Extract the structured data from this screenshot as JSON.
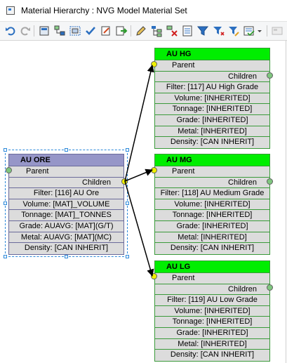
{
  "window": {
    "title": "Material Hierarchy : NVG Model Material Set"
  },
  "toolbar": {
    "items": [
      "undo-icon",
      "redo-icon",
      "layout-icon",
      "network-icon",
      "select-icon",
      "check-icon",
      "edit-icon",
      "export-icon",
      "pencil-icon",
      "tree-icon",
      "delete-icon",
      "properties-icon",
      "filter-icon",
      "filter-add-icon",
      "filter-edit-icon",
      "filter-clear-icon",
      "dropdown-icon",
      "disabled-icon"
    ]
  },
  "colors": {
    "green_header": "#00ee00",
    "purple_header": "#9696c8",
    "row_bg": "#dcdcdc",
    "selection": "#2c88d9"
  },
  "nodes": [
    {
      "id": "au-hg",
      "name": "AU HG",
      "parent": "Parent",
      "children": "Children",
      "rows": [
        "Filter: [117] AU High Grade",
        "Volume: [INHERITED]",
        "Tonnage: [INHERITED]",
        "Grade: [INHERITED]",
        "Metal: [INHERITED]",
        "Density: [CAN INHERIT]"
      ]
    },
    {
      "id": "au-ore",
      "name": "AU ORE",
      "parent": "Parent",
      "children": "Children",
      "rows": [
        "Filter: [116] AU Ore",
        "Volume: [MAT]_VOLUME",
        "Tonnage: [MAT]_TONNES",
        "Grade: AUAVG: [MAT](G/T)",
        "Metal: AUAVG: [MAT](MC)",
        "Density: [CAN INHERIT]"
      ]
    },
    {
      "id": "au-mg",
      "name": "AU MG",
      "parent": "Parent",
      "children": "Children",
      "rows": [
        "Filter: [118] AU Medium Grade",
        "Volume: [INHERITED]",
        "Tonnage: [INHERITED]",
        "Grade: [INHERITED]",
        "Metal: [INHERITED]",
        "Density: [CAN INHERIT]"
      ]
    },
    {
      "id": "au-lg",
      "name": "AU LG",
      "parent": "Parent",
      "children": "Children",
      "rows": [
        "Filter: [119] AU Low Grade",
        "Volume: [INHERITED]",
        "Tonnage: [INHERITED]",
        "Grade: [INHERITED]",
        "Metal: [INHERITED]",
        "Density: [CAN INHERIT]"
      ]
    }
  ]
}
